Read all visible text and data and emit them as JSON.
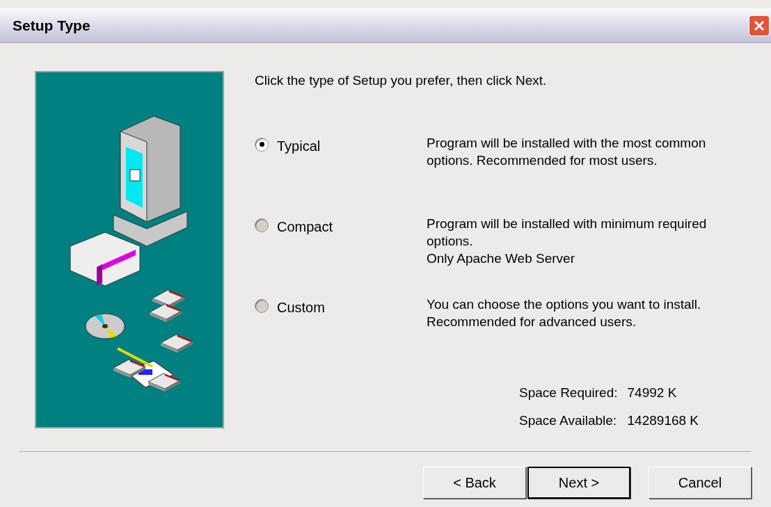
{
  "window": {
    "title": "Setup Type"
  },
  "instruction": "Click the type of Setup you prefer, then click Next.",
  "options": [
    {
      "label": "Typical",
      "selected": true,
      "description": [
        "Program will be installed with the most common",
        "options. Recommended for most users."
      ]
    },
    {
      "label": "Compact",
      "selected": false,
      "description": [
        "Program will be installed with minimum required",
        "options.",
        "Only Apache Web Server"
      ]
    },
    {
      "label": "Custom",
      "selected": false,
      "description": [
        "You can choose the options you want to install.",
        "Recommended for advanced users."
      ]
    }
  ],
  "space": [
    {
      "label": "Space Required:",
      "value": "74992 K"
    },
    {
      "label": "Space Available:",
      "value": "14289168 K"
    }
  ],
  "buttons": [
    {
      "label": "< Back",
      "default": false
    },
    {
      "label": "Next >",
      "default": true
    },
    {
      "label": "Cancel",
      "default": false
    }
  ]
}
